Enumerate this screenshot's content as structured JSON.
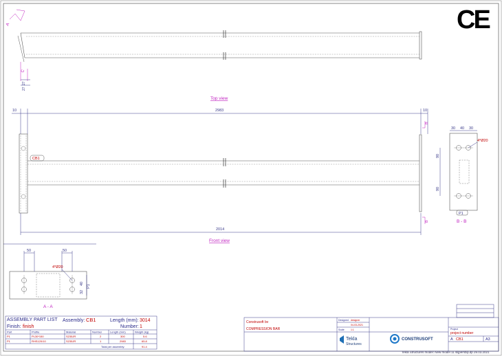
{
  "views": {
    "top_view": "Top view",
    "front_view": "Front view",
    "section_bb": "B - B",
    "section_aa": "A - A"
  },
  "dimensions": {
    "overall": "2983",
    "end_left": "10",
    "end_right": "10",
    "bar_length": "2014",
    "top_angle_a": "27",
    "top_angle_b": "27",
    "bb_30a": "30",
    "bb_40": "40",
    "bb_30b": "30",
    "bb_90a": "90",
    "bb_90b": "90",
    "bb_hole": "4*Ø20",
    "aa_50a": "50",
    "aa_50b": "50",
    "aa_hole": "4*Ø20",
    "aa_40": "40",
    "aa_32": "32"
  },
  "marks": {
    "cb1": "CB1",
    "p1": "P1",
    "a_mark": "A",
    "b_mark_top": "B",
    "b_mark_bottom": "B",
    "c_mark": "C"
  },
  "ce_mark": "CE",
  "assembly": {
    "title": "ASSEMBLY PART LIST",
    "assembly_label": "Assembly:",
    "assembly_value": "CB1",
    "length_label": "Length (mm):",
    "length_value": "3014",
    "finish_label": "Finish:",
    "finish_value": "finish",
    "number_label": "Number:",
    "number_value": "1",
    "columns": [
      "Part",
      "Profile",
      "Material",
      "Number",
      "Length (mm)",
      "Weight (kg)"
    ],
    "rows": [
      [
        "P1",
        "PL30*150",
        "S235JR",
        "2",
        "300",
        "5.6"
      ],
      [
        "P1",
        "RHS120/10",
        "S235JR",
        "1",
        "2983",
        "65.8"
      ]
    ],
    "total_label": "Total per assembly:",
    "total_value": "91.4"
  },
  "title_block": {
    "constructor": "Construsoft bv",
    "title": "COMPRESSION BAR",
    "designed_label": "Designed",
    "designed_value": "designer",
    "date_value": "04-03-2021",
    "scale_label": "Scale",
    "scale_value": "1:1",
    "tekla_brand": "Tekla",
    "tekla_sub": "Structures",
    "construsoft": "CONSTRUSOFT",
    "project_label": "Project",
    "project_number": "project number",
    "rev_label": "A",
    "drawing_id": "CB1",
    "sheet_size": "A3"
  },
  "footer": "Tekla Structures model: New model 11 slijpersbijl.dp 29.03.2021"
}
